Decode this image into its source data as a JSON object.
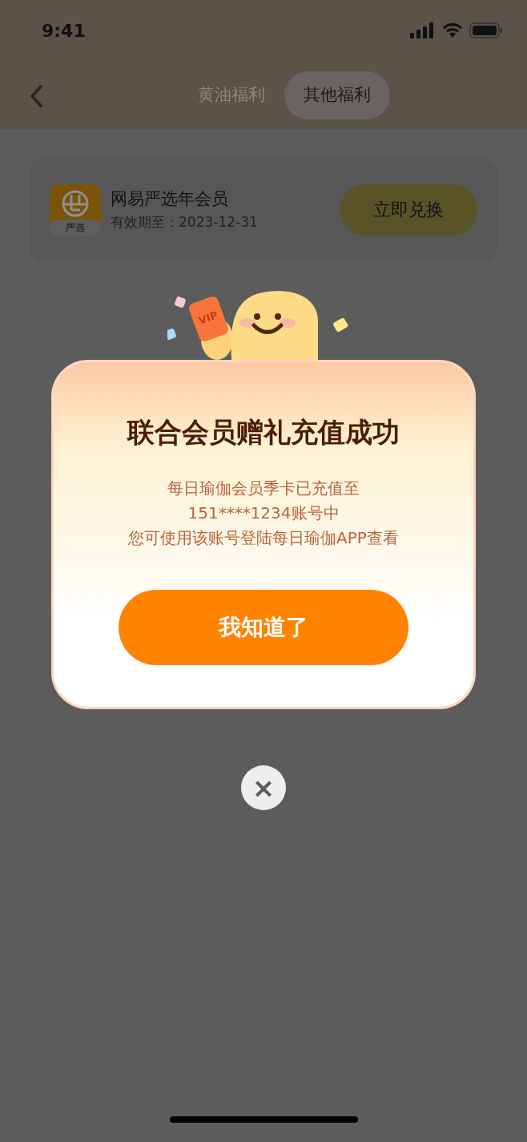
{
  "status_bar": {
    "time": "9:41"
  },
  "tabs": [
    {
      "label": "黄油福利",
      "selected": false
    },
    {
      "label": "其他福利",
      "selected": true
    }
  ],
  "benefit": {
    "logo_text": "严选",
    "title": "网易严选年会员",
    "expiry": "有效期至：2023-12-31",
    "button": "立即兑换"
  },
  "dialog": {
    "mascot_card_text": "VIP",
    "title": "联合会员赠礼充值成功",
    "message_lines": [
      "每日瑜伽会员季卡已充值至",
      "151****1234账号中",
      "您可使用该账号登陆每日瑜伽APP查看"
    ],
    "button": "我知道了",
    "close": "×"
  }
}
